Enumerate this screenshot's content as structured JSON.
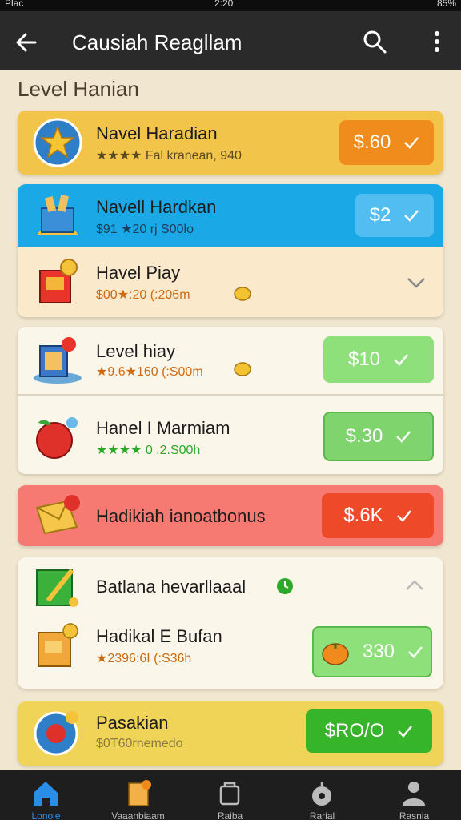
{
  "status_bar": {
    "left": "Plac",
    "time": "2:20",
    "right": "85%"
  },
  "app_bar": {
    "title": "Causiah Reagllam"
  },
  "section": {
    "title": "Level Hanian"
  },
  "items": [
    {
      "title": "Navel Haradian",
      "subtitle": "★★★★ Fal kranean, 940",
      "price": "$.60"
    },
    {
      "title": "Navell Hardkan",
      "subtitle": "$91 ★20 rj S00lo",
      "price": "$2"
    },
    {
      "title": "Havel Piay",
      "subtitle": "$00★:20 (:206m"
    },
    {
      "title": "Level hiay",
      "subtitle": "★9.6★160 (:S00m",
      "price": "$10"
    },
    {
      "title": "Hanel I Marmiam",
      "subtitle": "★★★★ 0 .2.S00h",
      "price": "$.30"
    },
    {
      "title": "Hadikiah ianoatbonus",
      "price": "$.6K"
    },
    {
      "title": "Batlana hevarllaaal"
    },
    {
      "title": "Hadikal E Bufan",
      "subtitle": "★2396:6I (:S36h",
      "price": "330"
    },
    {
      "title": "Pasakian",
      "subtitle": "$0T60rnemedo",
      "price": "$RO/O"
    }
  ],
  "nav": [
    {
      "label": "Lonoie"
    },
    {
      "label": "Vaaanbiaam"
    },
    {
      "label": "Raiba"
    },
    {
      "label": "Rarial"
    },
    {
      "label": "Rasnia"
    }
  ],
  "colors": {
    "accent_orange": "#f08c1c",
    "accent_blue": "#1aa8e6",
    "accent_green": "#8ee07a",
    "accent_red": "#ee4a2a",
    "bright_green": "#37b52a",
    "nav_active": "#2a8ee6"
  }
}
